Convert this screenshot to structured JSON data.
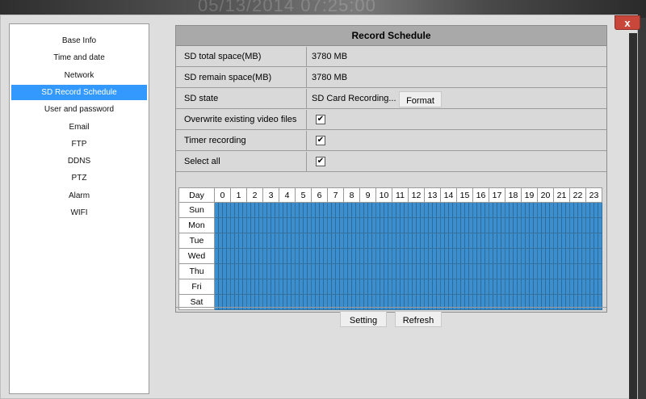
{
  "window": {
    "close_label": "x"
  },
  "background_text": "05/13/2014 07:25:00",
  "sidebar": {
    "items": [
      {
        "label": "Base Info"
      },
      {
        "label": "Time and date"
      },
      {
        "label": "Network"
      },
      {
        "label": "SD Record Schedule",
        "active": true
      },
      {
        "label": "User and password"
      },
      {
        "label": "Email"
      },
      {
        "label": "FTP"
      },
      {
        "label": "DDNS"
      },
      {
        "label": "PTZ"
      },
      {
        "label": "Alarm"
      },
      {
        "label": "WIFI"
      }
    ]
  },
  "panel": {
    "title": "Record Schedule",
    "rows": {
      "total": {
        "label": "SD total space(MB)",
        "value": "3780 MB"
      },
      "remain": {
        "label": "SD remain space(MB)",
        "value": "3780 MB"
      },
      "state": {
        "label": "SD state",
        "value": "SD Card Recording...",
        "button": "Format"
      },
      "overwrite": {
        "label": "Overwrite existing video files",
        "checked": true
      },
      "timer": {
        "label": "Timer recording",
        "checked": true
      },
      "selectall": {
        "label": "Select all",
        "checked": true
      }
    },
    "schedule": {
      "day_header": "Day",
      "hours": [
        "0",
        "1",
        "2",
        "3",
        "4",
        "5",
        "6",
        "7",
        "8",
        "9",
        "10",
        "11",
        "12",
        "13",
        "14",
        "15",
        "16",
        "17",
        "18",
        "19",
        "20",
        "21",
        "22",
        "23"
      ],
      "days": [
        "Sun",
        "Mon",
        "Tue",
        "Wed",
        "Thu",
        "Fri",
        "Sat"
      ],
      "all_slots_selected": true,
      "slot_color": "#3c8fcf"
    },
    "buttons": {
      "setting": "Setting",
      "refresh": "Refresh"
    }
  },
  "colors": {
    "accent": "#3399ff",
    "title_bar": "#a9a9a9",
    "close": "#c9463b"
  }
}
